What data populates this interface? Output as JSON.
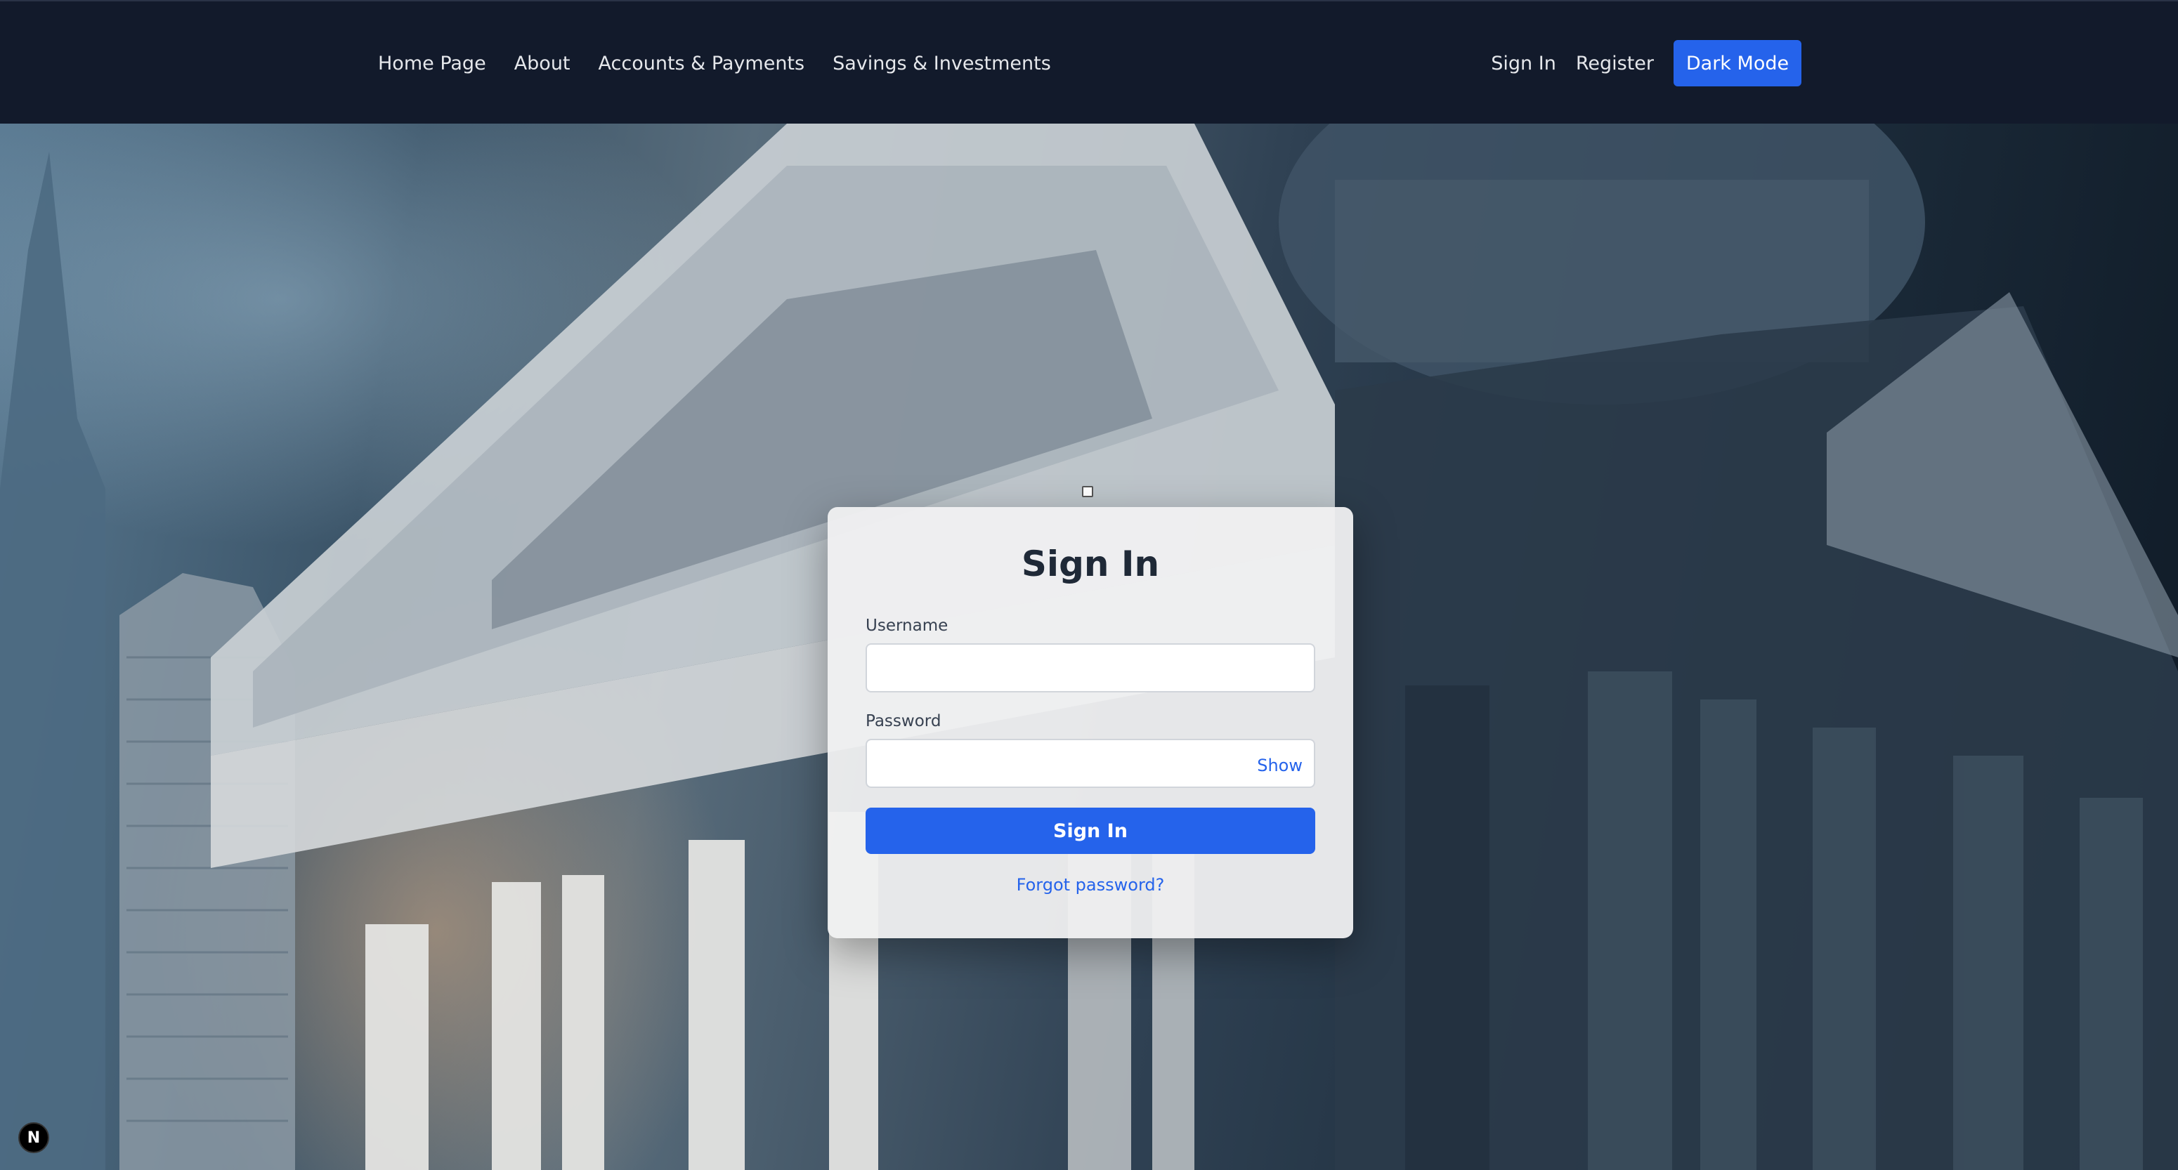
{
  "nav": {
    "left_links": [
      "Home Page",
      "About",
      "Accounts & Payments",
      "Savings & Investments"
    ],
    "sign_in": "Sign In",
    "register": "Register",
    "dark_mode": "Dark Mode"
  },
  "login": {
    "title": "Sign In",
    "username_label": "Username",
    "password_label": "Password",
    "show_label": "Show",
    "submit_label": "Sign In",
    "forgot_label": "Forgot password?"
  },
  "badge": {
    "text": "N"
  },
  "colors": {
    "nav_bg": "#121a2b",
    "accent": "#2563eb",
    "card_bg": "#f0f0f1"
  },
  "background": {
    "icon": "bank-building-photo"
  }
}
